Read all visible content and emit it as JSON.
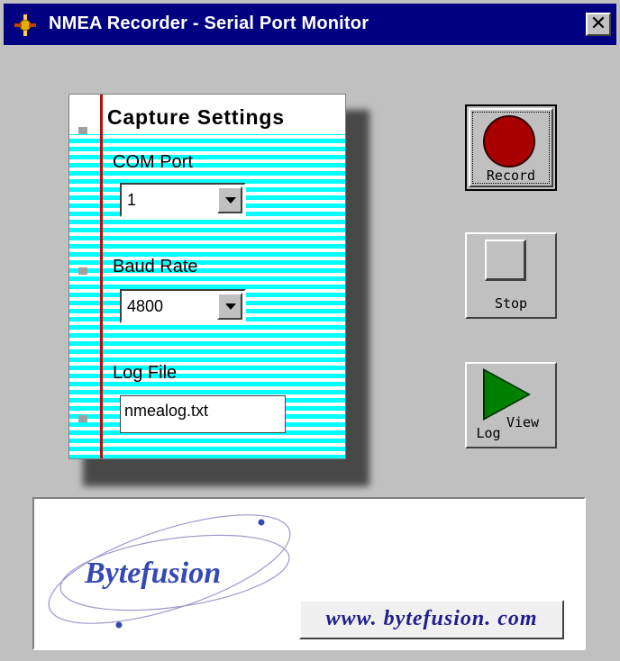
{
  "window": {
    "title": "NMEA Recorder - Serial Port Monitor",
    "close_glyph": "✕",
    "app_icon": "nmea-app-icon",
    "titlebar_color": "#000080"
  },
  "capture_settings": {
    "title": "Capture Settings",
    "com_port": {
      "label": "COM Port",
      "value": "1"
    },
    "baud_rate": {
      "label": "Baud Rate",
      "value": "4800"
    },
    "log_file": {
      "label": "Log File",
      "value": "nmealog.txt"
    }
  },
  "buttons": {
    "record": {
      "label": "Record",
      "icon": "record-circle-icon",
      "color": "#a80000"
    },
    "stop": {
      "label": "Stop",
      "icon": "stop-square-icon"
    },
    "view_log": {
      "label_line1": "View",
      "label_line2": "Log",
      "icon": "play-triangle-icon",
      "color": "#008000"
    }
  },
  "logo": {
    "brand": "Bytefusion",
    "url": "www. bytefusion. com",
    "brand_color": "#3648b4"
  }
}
